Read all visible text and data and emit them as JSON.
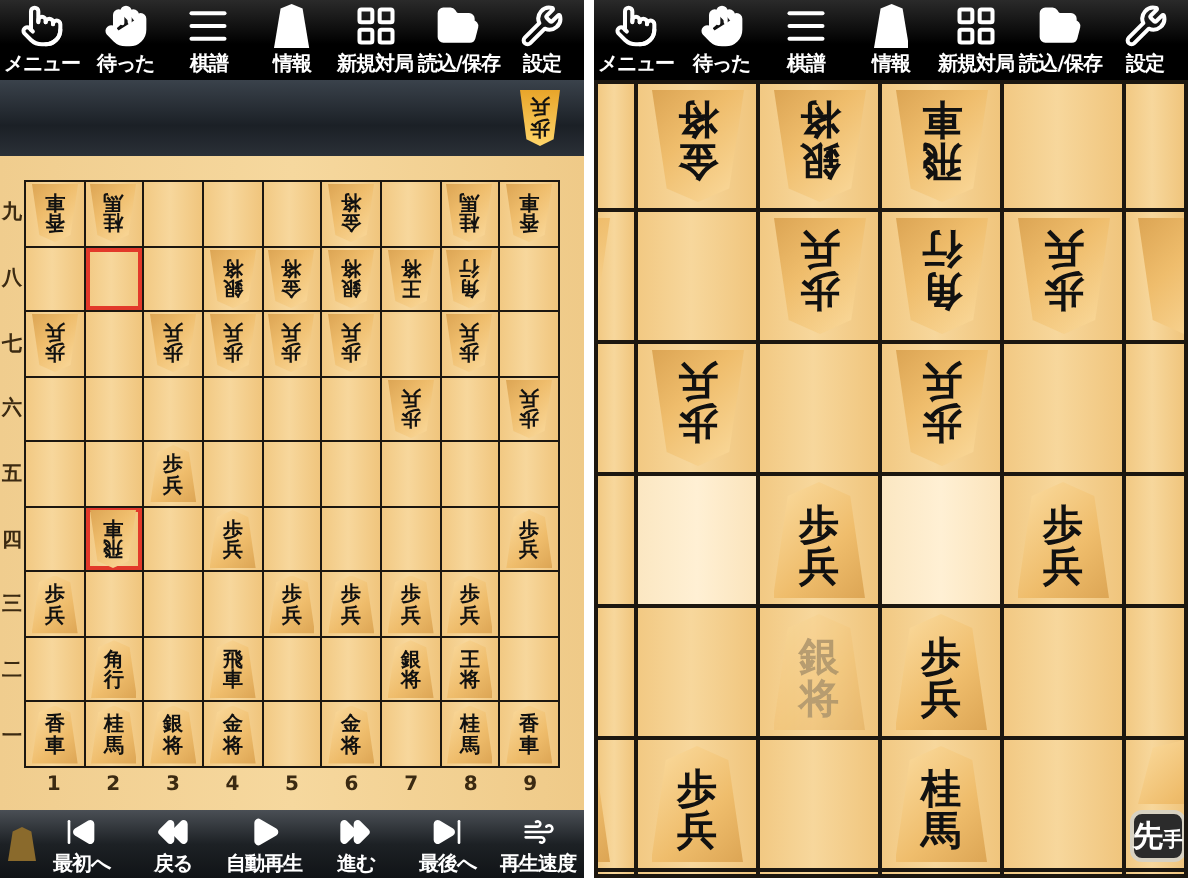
{
  "left_screen": {
    "toolbar": [
      {
        "label": "メニュー"
      },
      {
        "label": "待った"
      },
      {
        "label": "棋譜"
      },
      {
        "label": "情報"
      },
      {
        "label": "新規対局"
      },
      {
        "label": "読込/保存"
      },
      {
        "label": "設定"
      }
    ],
    "gote_hand": [
      {
        "name": "歩兵"
      }
    ],
    "rank_labels": [
      "九",
      "八",
      "七",
      "六",
      "五",
      "四",
      "三",
      "二",
      "一"
    ],
    "board": [
      [
        {
          "name": "香車",
          "gote": true,
          "marked": false
        },
        {
          "name": "桂馬",
          "gote": true,
          "marked": false
        },
        {
          "marked": false
        },
        {
          "marked": false
        },
        {
          "marked": false
        },
        {
          "name": "金将",
          "gote": true,
          "marked": false
        },
        {
          "marked": false
        },
        {
          "name": "桂馬",
          "gote": true,
          "marked": false
        },
        {
          "name": "香車",
          "gote": true,
          "marked": false
        }
      ],
      [
        {
          "marked": false
        },
        {
          "marked": true
        },
        {
          "marked": false
        },
        {
          "name": "銀将",
          "gote": true,
          "marked": false
        },
        {
          "name": "金将",
          "gote": true,
          "marked": false
        },
        {
          "name": "銀将",
          "gote": true,
          "marked": false
        },
        {
          "name": "王将",
          "gote": true,
          "marked": false
        },
        {
          "name": "角行",
          "gote": true,
          "marked": false
        },
        {
          "marked": false
        }
      ],
      [
        {
          "name": "歩兵",
          "gote": true,
          "marked": false
        },
        {
          "marked": false
        },
        {
          "name": "歩兵",
          "gote": true,
          "marked": false
        },
        {
          "name": "歩兵",
          "gote": true,
          "marked": false
        },
        {
          "name": "歩兵",
          "gote": true,
          "marked": false
        },
        {
          "name": "歩兵",
          "gote": true,
          "marked": false
        },
        {
          "marked": false
        },
        {
          "name": "歩兵",
          "gote": true,
          "marked": false
        },
        {
          "marked": false
        }
      ],
      [
        {
          "marked": false
        },
        {
          "marked": false
        },
        {
          "marked": false
        },
        {
          "marked": false
        },
        {
          "marked": false
        },
        {
          "marked": false
        },
        {
          "name": "歩兵",
          "gote": true,
          "marked": false
        },
        {
          "marked": false
        },
        {
          "name": "歩兵",
          "gote": true,
          "marked": false
        }
      ],
      [
        {
          "marked": false
        },
        {
          "marked": false
        },
        {
          "name": "歩兵",
          "gote": false,
          "marked": false
        },
        {
          "marked": false
        },
        {
          "marked": false
        },
        {
          "marked": false
        },
        {
          "marked": false
        },
        {
          "marked": false
        },
        {
          "marked": false
        }
      ],
      [
        {
          "marked": false
        },
        {
          "name": "飛車",
          "gote": true,
          "marked": true
        },
        {
          "marked": false
        },
        {
          "name": "歩兵",
          "gote": false,
          "marked": false
        },
        {
          "marked": false
        },
        {
          "marked": false
        },
        {
          "marked": false
        },
        {
          "marked": false
        },
        {
          "name": "歩兵",
          "gote": false,
          "marked": false
        }
      ],
      [
        {
          "name": "歩兵",
          "gote": false,
          "marked": false
        },
        {
          "marked": false
        },
        {
          "marked": false
        },
        {
          "marked": false
        },
        {
          "name": "歩兵",
          "gote": false,
          "marked": false
        },
        {
          "name": "歩兵",
          "gote": false,
          "marked": false
        },
        {
          "name": "歩兵",
          "gote": false,
          "marked": false
        },
        {
          "name": "歩兵",
          "gote": false,
          "marked": false
        },
        {
          "marked": false
        }
      ],
      [
        {
          "marked": false
        },
        {
          "name": "角行",
          "gote": false,
          "marked": false
        },
        {
          "marked": false
        },
        {
          "name": "飛車",
          "gote": false,
          "marked": false
        },
        {
          "marked": false
        },
        {
          "marked": false
        },
        {
          "name": "銀将",
          "gote": false,
          "marked": false
        },
        {
          "name": "王将",
          "gote": false,
          "marked": false
        },
        {
          "marked": false
        }
      ],
      [
        {
          "name": "香車",
          "gote": false,
          "marked": false
        },
        {
          "name": "桂馬",
          "gote": false,
          "marked": false
        },
        {
          "name": "銀将",
          "gote": false,
          "marked": false
        },
        {
          "name": "金将",
          "gote": false,
          "marked": false
        },
        {
          "marked": false
        },
        {
          "name": "金将",
          "gote": false,
          "marked": false
        },
        {
          "marked": false
        },
        {
          "name": "桂馬",
          "gote": false,
          "marked": false
        },
        {
          "name": "香車",
          "gote": false,
          "marked": false
        }
      ]
    ],
    "file_labels": [
      "1",
      "2",
      "3",
      "4",
      "5",
      "6",
      "7",
      "8",
      "9"
    ],
    "playback_bar": [
      {
        "label": "最初へ"
      },
      {
        "label": "戻る"
      },
      {
        "label": "自動再生"
      },
      {
        "label": "進む"
      },
      {
        "label": "最後へ"
      },
      {
        "label": "再生速度"
      }
    ]
  },
  "right_screen": {
    "toolbar": [
      {
        "label": "メニュー"
      },
      {
        "label": "待った"
      },
      {
        "label": "棋譜"
      },
      {
        "label": "情報"
      },
      {
        "label": "新規対局"
      },
      {
        "label": "読込/保存"
      },
      {
        "label": "設定"
      }
    ],
    "board": [
      [
        {
          "highlighted": false
        },
        {
          "name": "金将",
          "gote": true,
          "faded": false,
          "highlighted": false
        },
        {
          "name": "銀将",
          "gote": true,
          "faded": false,
          "highlighted": false
        },
        {
          "name": "飛車",
          "gote": true,
          "faded": false,
          "highlighted": false
        },
        {
          "highlighted": false
        },
        {
          "highlighted": false
        }
      ],
      [
        {
          "gote": true,
          "highlighted": false
        },
        {
          "highlighted": false
        },
        {
          "name": "歩兵",
          "gote": true,
          "faded": false,
          "highlighted": false
        },
        {
          "name": "角行",
          "gote": true,
          "faded": false,
          "highlighted": false
        },
        {
          "name": "歩兵",
          "gote": true,
          "faded": false,
          "highlighted": false
        },
        {
          "gote": true,
          "highlighted": false
        }
      ],
      [
        {
          "highlighted": false
        },
        {
          "name": "歩兵",
          "gote": true,
          "faded": false,
          "highlighted": false
        },
        {
          "highlighted": false
        },
        {
          "name": "歩兵",
          "gote": true,
          "faded": false,
          "highlighted": false
        },
        {
          "highlighted": false
        },
        {
          "highlighted": false
        }
      ],
      [
        {
          "highlighted": false
        },
        {
          "highlighted": true
        },
        {
          "name": "歩兵",
          "gote": false,
          "faded": false,
          "highlighted": false
        },
        {
          "highlighted": true
        },
        {
          "name": "歩兵",
          "gote": false,
          "faded": false,
          "highlighted": false
        },
        {
          "highlighted": false
        }
      ],
      [
        {
          "highlighted": false
        },
        {
          "highlighted": false
        },
        {
          "name": "銀将",
          "gote": false,
          "faded": true,
          "highlighted": false
        },
        {
          "name": "歩兵",
          "gote": false,
          "faded": false,
          "highlighted": false
        },
        {
          "highlighted": false
        },
        {
          "highlighted": false
        }
      ],
      [
        {
          "gote": false,
          "highlighted": false
        },
        {
          "name": "歩兵",
          "gote": false,
          "faded": false,
          "highlighted": false
        },
        {
          "highlighted": false
        },
        {
          "name": "桂馬",
          "gote": false,
          "faded": false,
          "highlighted": false
        },
        {
          "highlighted": false
        },
        {
          "gote": false,
          "highlighted": false
        }
      ]
    ],
    "turn_badge": {
      "main": "先",
      "sub": "手"
    }
  }
}
